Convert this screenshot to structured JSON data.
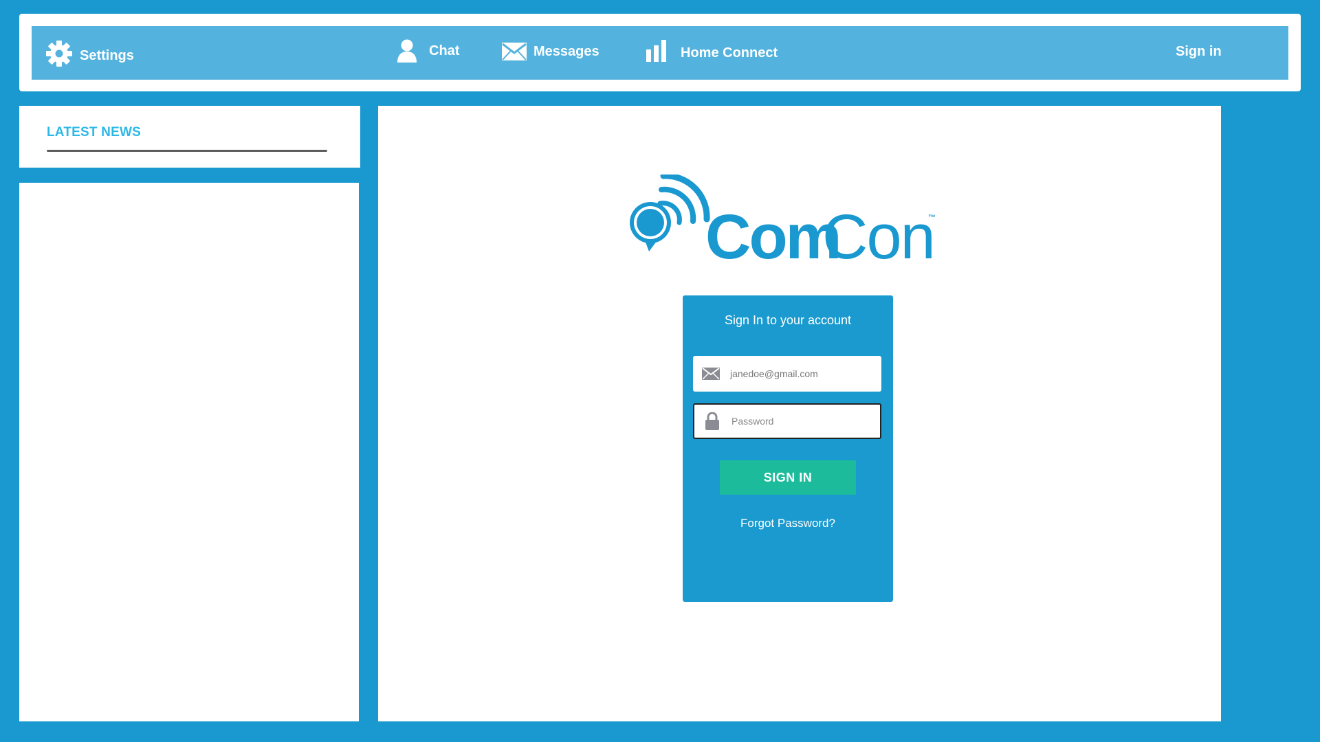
{
  "nav": {
    "settings": {
      "label": "Settings",
      "icon": "gear-icon"
    },
    "chat": {
      "label": "Chat",
      "icon": "user-icon"
    },
    "messages": {
      "label": "Messages",
      "icon": "envelope-icon"
    },
    "home_connect": {
      "label": "Home Connect",
      "icon": "bar-chart-icon"
    },
    "sign_in": {
      "label": "Sign in"
    }
  },
  "sidebar": {
    "news_title": "LATEST NEWS"
  },
  "logo": {
    "part1": "Com",
    "part2": "Con",
    "trademark": "™",
    "icon": "wifi-chat-bubble-icon"
  },
  "login": {
    "heading": "Sign In to your account",
    "email_value": "janedoe@gmail.com",
    "password_placeholder": "Password",
    "submit_label": "SIGN IN",
    "forgot_label": "Forgot Password?"
  },
  "colors": {
    "background": "#1999cf",
    "nav_bar": "#53b3de",
    "accent": "#2cb8e6",
    "button": "#1cbb9b",
    "logo_blue": "#1a98d0"
  }
}
